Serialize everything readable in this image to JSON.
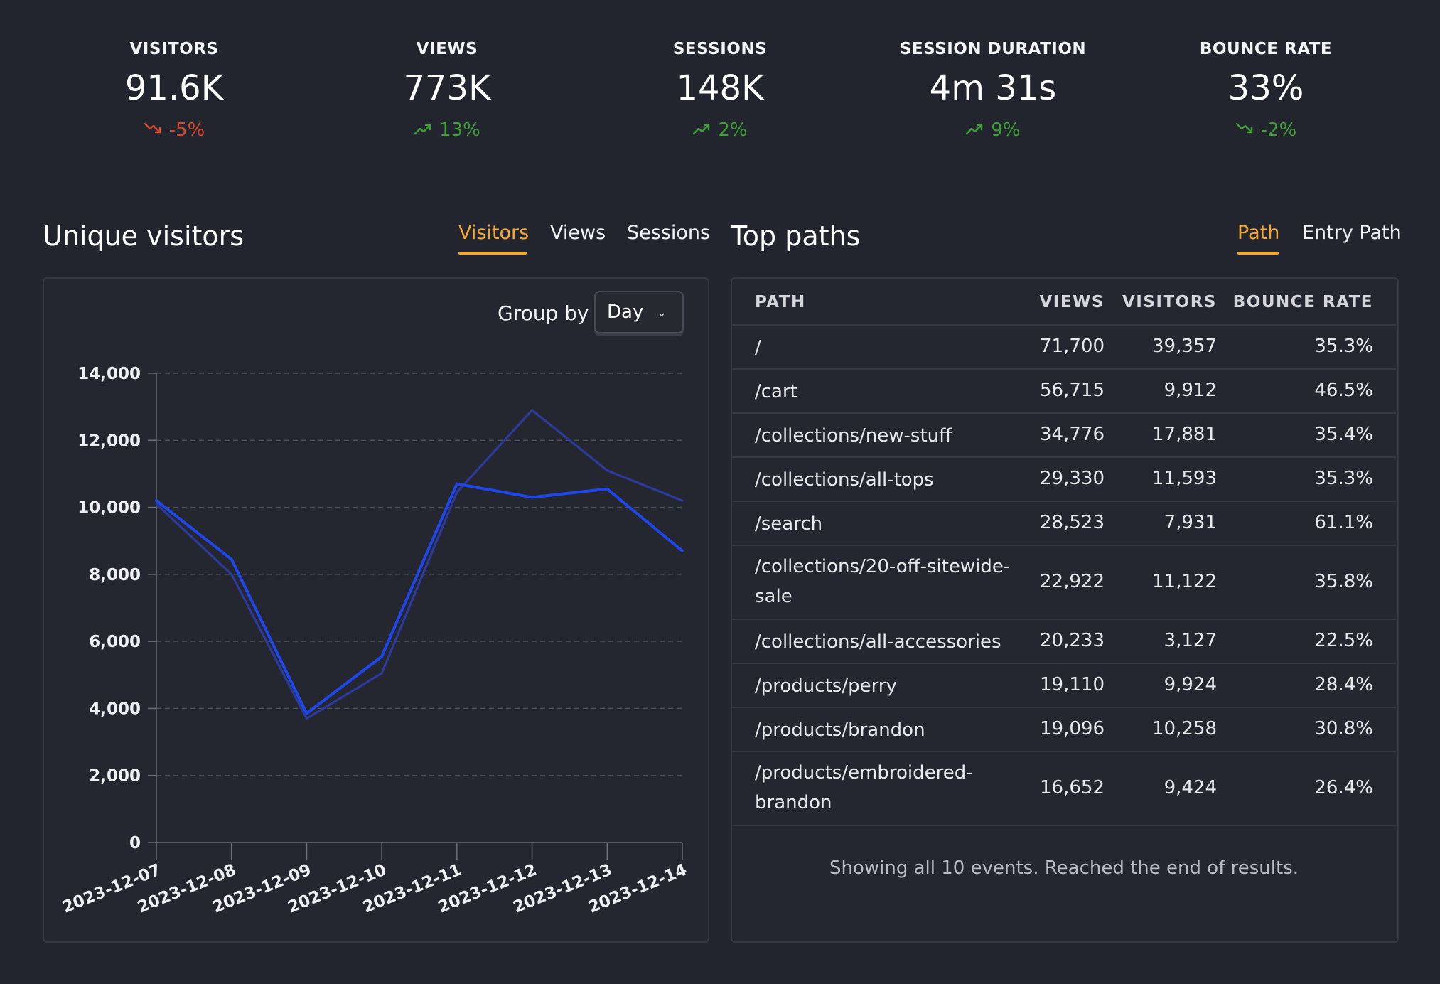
{
  "kpis": [
    {
      "label": "VISITORS",
      "value": "91.6K",
      "delta": "-5%",
      "trend": "down",
      "color": "#d9482b"
    },
    {
      "label": "VIEWS",
      "value": "773K",
      "delta": "13%",
      "trend": "up",
      "color": "#3fa037"
    },
    {
      "label": "SESSIONS",
      "value": "148K",
      "delta": "2%",
      "trend": "up",
      "color": "#3fa037"
    },
    {
      "label": "SESSION DURATION",
      "value": "4m 31s",
      "delta": "9%",
      "trend": "up",
      "color": "#3fa037"
    },
    {
      "label": "BOUNCE RATE",
      "value": "33%",
      "delta": "-2%",
      "trend": "down",
      "color": "#3fa037"
    }
  ],
  "visitors_section": {
    "title": "Unique visitors",
    "tabs": [
      "Visitors",
      "Views",
      "Sessions"
    ],
    "active_tab": "Visitors",
    "group_by_label": "Group by",
    "group_by_value": "Day"
  },
  "paths_section": {
    "title": "Top paths",
    "tabs": [
      "Path",
      "Entry Path"
    ],
    "active_tab": "Path",
    "columns": [
      "PATH",
      "VIEWS",
      "VISITORS",
      "BOUNCE RATE"
    ],
    "rows": [
      {
        "path": "/",
        "views": "71,700",
        "visitors": "39,357",
        "bounce": "35.3%"
      },
      {
        "path": "/cart",
        "views": "56,715",
        "visitors": "9,912",
        "bounce": "46.5%"
      },
      {
        "path": "/collections/new-stuff",
        "views": "34,776",
        "visitors": "17,881",
        "bounce": "35.4%"
      },
      {
        "path": "/collections/all-tops",
        "views": "29,330",
        "visitors": "11,593",
        "bounce": "35.3%"
      },
      {
        "path": "/search",
        "views": "28,523",
        "visitors": "7,931",
        "bounce": "61.1%"
      },
      {
        "path": "/collections/20-off-sitewide-sale",
        "path_lines": [
          "/collections/20-off-sitewide-",
          "sale"
        ],
        "views": "22,922",
        "visitors": "11,122",
        "bounce": "35.8%"
      },
      {
        "path": "/collections/all-accessories",
        "views": "20,233",
        "visitors": "3,127",
        "bounce": "22.5%"
      },
      {
        "path": "/products/perry",
        "views": "19,110",
        "visitors": "9,924",
        "bounce": "28.4%"
      },
      {
        "path": "/products/brandon",
        "views": "19,096",
        "visitors": "10,258",
        "bounce": "30.8%"
      },
      {
        "path": "/products/embroidered-brandon",
        "path_lines": [
          "/products/embroidered-",
          "brandon"
        ],
        "views": "16,652",
        "visitors": "9,424",
        "bounce": "26.4%"
      }
    ],
    "footer": "Showing all 10 events. Reached the end of results."
  },
  "chart_data": {
    "type": "line",
    "x": [
      "2023-12-07",
      "2023-12-08",
      "2023-12-09",
      "2023-12-10",
      "2023-12-11",
      "2023-12-12",
      "2023-12-13",
      "2023-12-14"
    ],
    "series": [
      {
        "values": [
          10100,
          8000,
          3700,
          5050,
          10450,
          12900,
          11100,
          10200
        ],
        "color": "#2c3a9c"
      },
      {
        "values": [
          10200,
          8450,
          3850,
          5550,
          10700,
          10300,
          10550,
          8700
        ],
        "color": "#1f46ea"
      }
    ],
    "ylim": [
      0,
      14000
    ],
    "yticks": [
      "0",
      "2,000",
      "4,000",
      "6,000",
      "8,000",
      "10,000",
      "12,000",
      "14,000"
    ],
    "ytick_values": [
      0,
      2000,
      4000,
      6000,
      8000,
      10000,
      12000,
      14000
    ],
    "grid": true
  }
}
